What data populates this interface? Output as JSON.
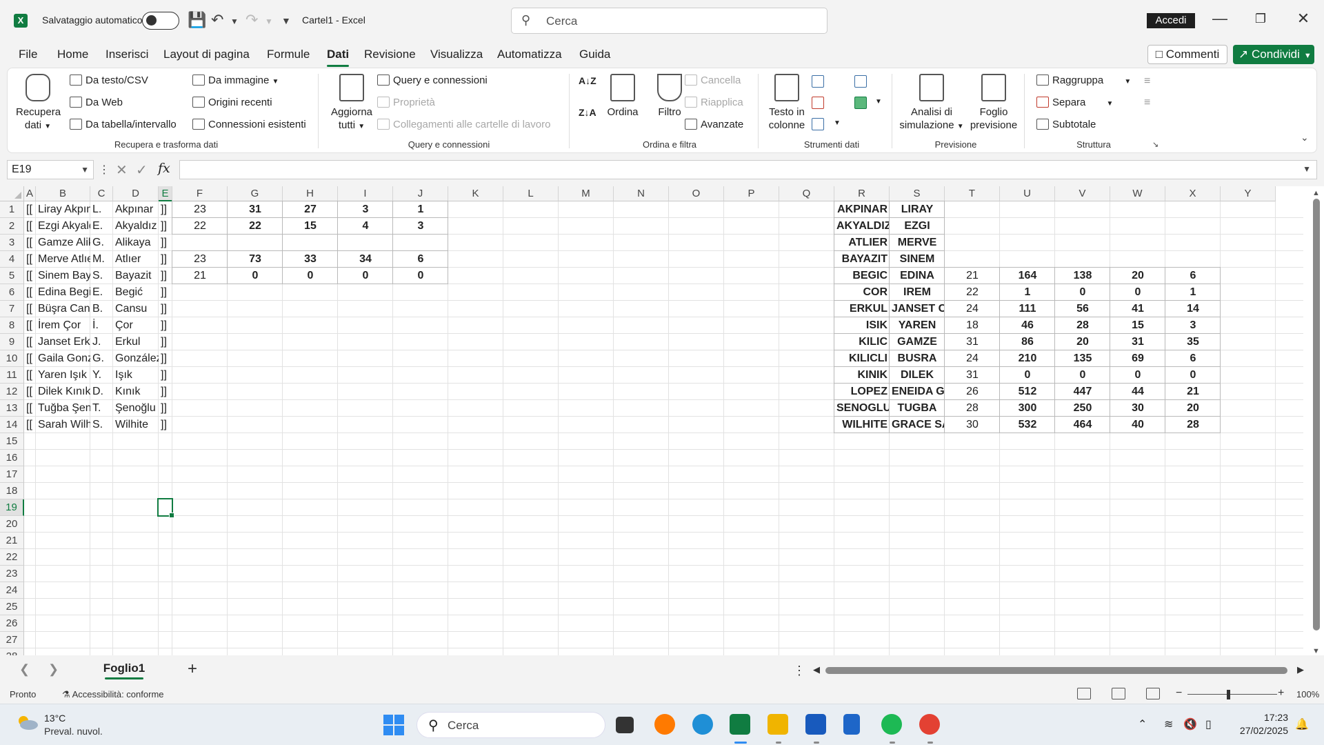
{
  "titlebar": {
    "autosave_label": "Salvataggio automatico",
    "doc_title": "Cartel1  -  Excel",
    "search_placeholder": "Cerca",
    "signin": "Accedi"
  },
  "menu": {
    "tabs": [
      "File",
      "Home",
      "Inserisci",
      "Layout di pagina",
      "Formule",
      "Dati",
      "Revisione",
      "Visualizza",
      "Automatizza",
      "Guida"
    ],
    "active": "Dati",
    "comments": "Commenti",
    "share": "Condividi"
  },
  "ribbon": {
    "get_data": "Recupera dati",
    "get_data_l1": "Recupera",
    "get_data_l2": "dati",
    "from_text": "Da testo/CSV",
    "from_web": "Da Web",
    "from_table": "Da tabella/intervallo",
    "from_image": "Da immagine",
    "recent_sources": "Origini recenti",
    "existing_connections": "Connessioni esistenti",
    "group1": "Recupera e trasforma dati",
    "refresh_l1": "Aggiorna",
    "refresh_l2": "tutti",
    "queries_connections": "Query e connessioni",
    "properties": "Proprietà",
    "workbook_links": "Collegamenti alle cartelle di lavoro",
    "group2": "Query e connessioni",
    "sort": "Ordina",
    "filter": "Filtro",
    "clear": "Cancella",
    "reapply": "Riapplica",
    "advanced": "Avanzate",
    "group3": "Ordina e filtra",
    "text_to_columns_l1": "Testo in",
    "text_to_columns_l2": "colonne",
    "group4": "Strumenti dati",
    "whatif_l1": "Analisi di",
    "whatif_l2": "simulazione",
    "forecast_l1": "Foglio",
    "forecast_l2": "previsione",
    "group5": "Previsione",
    "group_btn": "Raggruppa",
    "ungroup_btn": "Separa",
    "subtotal": "Subtotale",
    "group6": "Struttura"
  },
  "formula_bar": {
    "name_box": "E19",
    "fx": "fx",
    "formula": ""
  },
  "grid": {
    "columns": [
      "A",
      "B",
      "C",
      "D",
      "E",
      "F",
      "G",
      "H",
      "I",
      "J",
      "K",
      "L",
      "M",
      "N",
      "O",
      "P",
      "Q",
      "R",
      "S",
      "T",
      "U",
      "V",
      "W",
      "X",
      "Y"
    ],
    "rows": [
      "1",
      "2",
      "3",
      "4",
      "5",
      "6",
      "7",
      "8",
      "9",
      "10",
      "11",
      "12",
      "13",
      "14",
      "15",
      "16",
      "17",
      "18",
      "19",
      "20",
      "21",
      "22",
      "23",
      "24",
      "25",
      "26",
      "27",
      "28"
    ],
    "selected_cell": "E19",
    "left_block": [
      {
        "a": "[[",
        "b": "Liray Akpınar",
        "c": "L.",
        "d": "Akpınar",
        "e": "]]"
      },
      {
        "a": "[[",
        "b": "Ezgi Akyaldız",
        "c": "E.",
        "d": "Akyaldız",
        "e": "]]"
      },
      {
        "a": "[[",
        "b": "Gamze Alikaya",
        "c": "G.",
        "d": "Alikaya",
        "e": "]]"
      },
      {
        "a": "[[",
        "b": "Merve Atlıer",
        "c": "M.",
        "d": "Atlıer",
        "e": "]]"
      },
      {
        "a": "[[",
        "b": "Sinem Bayazit",
        "c": "S.",
        "d": "Bayazit",
        "e": "]]"
      },
      {
        "a": "[[",
        "b": "Edina Begić",
        "c": "E.",
        "d": "Begić",
        "e": "]]"
      },
      {
        "a": "[[",
        "b": "Büşra Cansu",
        "c": "B.",
        "d": "Cansu",
        "e": "]]"
      },
      {
        "a": "[[",
        "b": "İrem Çor",
        "c": "İ.",
        "d": "Çor",
        "e": "]]"
      },
      {
        "a": "[[",
        "b": "Janset Erkul",
        "c": "J.",
        "d": "Erkul",
        "e": "]]"
      },
      {
        "a": "[[",
        "b": "Gaila González",
        "c": "G.",
        "d": "González",
        "e": "]]"
      },
      {
        "a": "[[",
        "b": "Yaren Işık",
        "c": "Y.",
        "d": "Işık",
        "e": "]]"
      },
      {
        "a": "[[",
        "b": "Dilek Kınık",
        "c": "D.",
        "d": "Kınık",
        "e": "]]"
      },
      {
        "a": "[[",
        "b": "Tuğba Şenoğlu",
        "c": "T.",
        "d": "Şenoğlu",
        "e": "]]"
      },
      {
        "a": "[[",
        "b": "Sarah Wilhite",
        "c": "S.",
        "d": "Wilhite",
        "e": "]]"
      }
    ],
    "stats_block": [
      {
        "f": "23",
        "g": "31",
        "h": "27",
        "i": "3",
        "j": "1"
      },
      {
        "f": "22",
        "g": "22",
        "h": "15",
        "i": "4",
        "j": "3"
      },
      {
        "f": "",
        "g": "",
        "h": "",
        "i": "",
        "j": ""
      },
      {
        "f": "23",
        "g": "73",
        "h": "33",
        "i": "34",
        "j": "6"
      },
      {
        "f": "21",
        "g": "0",
        "h": "0",
        "i": "0",
        "j": "0"
      }
    ],
    "right_block": [
      {
        "r": "AKPINAR",
        "s": "LIRAY",
        "t": "",
        "u": "",
        "v": "",
        "w": "",
        "x": ""
      },
      {
        "r": "AKYALDIZ",
        "s": "EZGI",
        "t": "",
        "u": "",
        "v": "",
        "w": "",
        "x": ""
      },
      {
        "r": "ATLIER",
        "s": "MERVE",
        "t": "",
        "u": "",
        "v": "",
        "w": "",
        "x": ""
      },
      {
        "r": "BAYAZIT",
        "s": "SINEM",
        "t": "",
        "u": "",
        "v": "",
        "w": "",
        "x": ""
      },
      {
        "r": "BEGIC",
        "s": "EDINA",
        "t": "21",
        "u": "164",
        "v": "138",
        "w": "20",
        "x": "6"
      },
      {
        "r": "COR",
        "s": "IREM",
        "t": "22",
        "u": "1",
        "v": "0",
        "w": "0",
        "x": "1"
      },
      {
        "r": "ERKUL",
        "s": "JANSET CEM",
        "t": "24",
        "u": "111",
        "v": "56",
        "w": "41",
        "x": "14"
      },
      {
        "r": "ISIK",
        "s": "YAREN",
        "t": "18",
        "u": "46",
        "v": "28",
        "w": "15",
        "x": "3"
      },
      {
        "r": "KILIC",
        "s": "GAMZE",
        "t": "31",
        "u": "86",
        "v": "20",
        "w": "31",
        "x": "35"
      },
      {
        "r": "KILICLI",
        "s": "BUSRA",
        "t": "24",
        "u": "210",
        "v": "135",
        "w": "69",
        "x": "6"
      },
      {
        "r": "KINIK",
        "s": "DILEK",
        "t": "31",
        "u": "0",
        "v": "0",
        "w": "0",
        "x": "0"
      },
      {
        "r": "LOPEZ",
        "s": "ENEIDA GC",
        "t": "26",
        "u": "512",
        "v": "447",
        "w": "44",
        "x": "21"
      },
      {
        "r": "SENOGLU IVE",
        "s": "TUGBA",
        "t": "28",
        "u": "300",
        "v": "250",
        "w": "30",
        "x": "20"
      },
      {
        "r": "WILHITE",
        "s": "GRACE SARA",
        "t": "30",
        "u": "532",
        "v": "464",
        "w": "40",
        "x": "28"
      }
    ]
  },
  "sheets": {
    "active": "Foglio1",
    "add": "+"
  },
  "status": {
    "ready": "Pronto",
    "accessibility": "Accessibilità: conforme",
    "zoom": "100%"
  },
  "taskbar": {
    "temperature": "13°C",
    "condition": "Preval. nuvol.",
    "search_placeholder": "Cerca",
    "time": "17:23",
    "date": "27/02/2025"
  },
  "colors": {
    "accent": "#107c41",
    "share_bg": "#107c41"
  }
}
